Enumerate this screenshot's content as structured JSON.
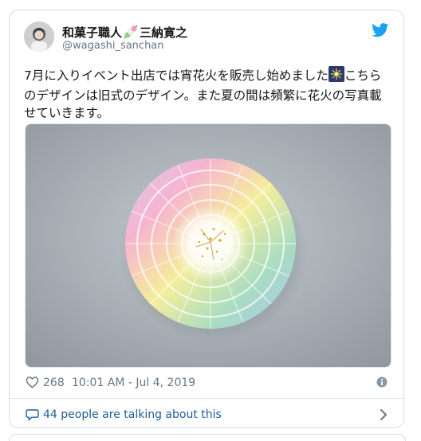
{
  "tweet": {
    "author_name": "和菓子職人",
    "author_name_suffix": "三納寛之",
    "author_handle": "@wagashi_sanchan",
    "text_line1": "7月に入りイベント出店では宵花火を販売し始めました",
    "text_rest": "こちらのデザインは旧式のデザイン。また夏の間は頻繁に花火の写真載せていきます。",
    "likes": "268",
    "timestamp": "10:01 AM - Jul 4, 2019",
    "talking": "44 people are talking about this"
  },
  "icons": {
    "logo": "twitter-bird-icon",
    "like": "heart-icon",
    "info": "info-icon",
    "reply": "speech-bubble-icon",
    "more": "chevron-right-icon",
    "name_emoji": "dango-icon",
    "text_emoji": "fireworks-icon"
  },
  "colors": {
    "accent": "#1da1f2",
    "link": "#1b5f9c",
    "secondary_text": "#657786",
    "border": "#e1e8ed"
  }
}
